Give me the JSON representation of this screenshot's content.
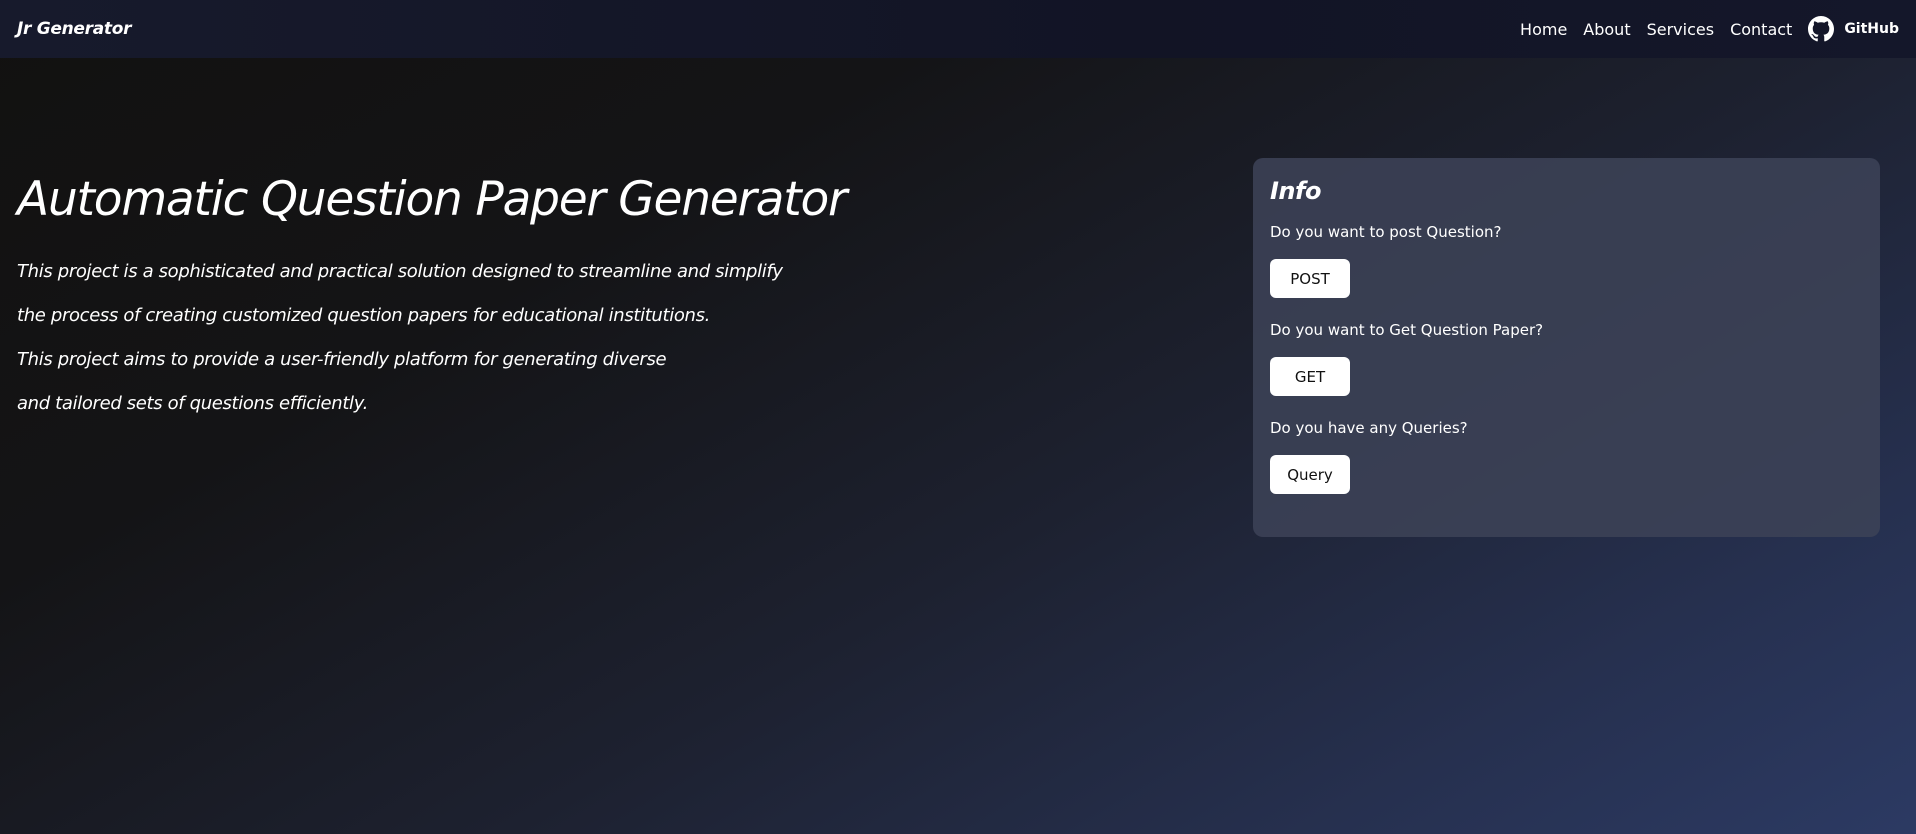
{
  "navbar": {
    "brand": "Jr Generator",
    "links": [
      "Home",
      "About",
      "Services",
      "Contact"
    ],
    "github_label": "GitHub"
  },
  "hero": {
    "title": "Automatic Question Paper Generator",
    "lines": [
      "This project is a sophisticated and practical solution designed to streamline and simplify",
      "the process of creating customized question papers for educational institutions.",
      "This project aims to provide a user-friendly platform for generating diverse",
      "and tailored sets of questions efficiently."
    ]
  },
  "info": {
    "title": "Info",
    "items": [
      {
        "question": "Do you want to post Question?",
        "button": "POST"
      },
      {
        "question": "Do you want to Get Question Paper?",
        "button": "GET"
      },
      {
        "question": "Do you have any Queries?",
        "button": "Query"
      }
    ]
  },
  "colors": {
    "navbar_bg": "#141628",
    "card_bg": "#3c4256",
    "button_bg": "#ffffff",
    "text": "#ffffff"
  },
  "icons": {
    "github": "github-icon"
  }
}
